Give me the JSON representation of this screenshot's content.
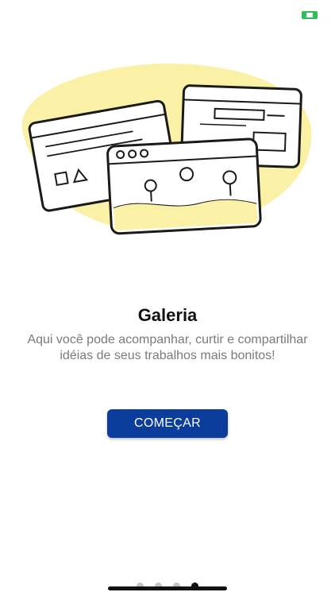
{
  "onboarding": {
    "title": "Galeria",
    "description": "Aqui você pode acompanhar, curtir e compartilhar idéias de seus trabalhos mais bonitos!",
    "cta_label": "COMEÇAR",
    "page_count": 4,
    "current_page": 4
  },
  "status_bar": {
    "battery_icon": "battery-icon"
  },
  "illustration": {
    "name": "gallery-windows-illustration"
  },
  "colors": {
    "accent": "#0a3d9c",
    "illustration_blob": "#fbf1a6",
    "dot_inactive": "#c4c4c4",
    "dot_active": "#111111"
  }
}
